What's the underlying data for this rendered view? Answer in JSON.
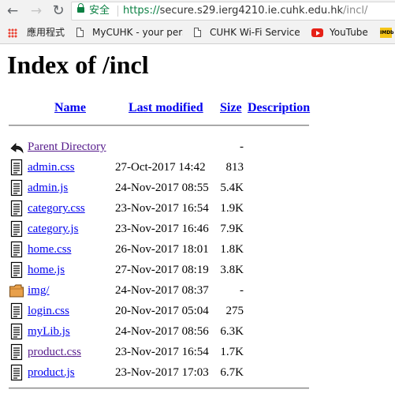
{
  "browser": {
    "secure_label": "安全",
    "url_scheme": "https://",
    "url_host": "secure.s29.ierg4210.ie.cuhk.edu.hk",
    "url_path": "/incl/"
  },
  "bookmarks": {
    "apps_label": "應用程式",
    "items": [
      {
        "label": "MyCUHK - your pers",
        "icon": "page-icon"
      },
      {
        "label": "CUHK Wi-Fi Service",
        "icon": "page-icon"
      },
      {
        "label": "YouTube",
        "icon": "youtube-icon"
      },
      {
        "label": "IMDb",
        "icon": "imdb-icon"
      }
    ]
  },
  "page": {
    "title": "Index of /incl",
    "columns": {
      "name": "Name",
      "last_modified": "Last modified",
      "size": "Size",
      "description": "Description"
    },
    "parent": {
      "label": "Parent Directory",
      "size": "-"
    },
    "files": [
      {
        "name": "admin.css",
        "date": "27-Oct-2017 14:42",
        "size": "813",
        "type": "text"
      },
      {
        "name": "admin.js",
        "date": "24-Nov-2017 08:55",
        "size": "5.4K",
        "type": "text"
      },
      {
        "name": "category.css",
        "date": "23-Nov-2017 16:54",
        "size": "1.9K",
        "type": "text"
      },
      {
        "name": "category.js",
        "date": "23-Nov-2017 16:46",
        "size": "7.9K",
        "type": "text"
      },
      {
        "name": "home.css",
        "date": "26-Nov-2017 18:01",
        "size": "1.8K",
        "type": "text"
      },
      {
        "name": "home.js",
        "date": "27-Nov-2017 08:19",
        "size": "3.8K",
        "type": "text"
      },
      {
        "name": "img/",
        "date": "24-Nov-2017 08:37",
        "size": "-",
        "type": "folder"
      },
      {
        "name": "login.css",
        "date": "20-Nov-2017 05:04",
        "size": "275",
        "type": "text"
      },
      {
        "name": "myLib.js",
        "date": "24-Nov-2017 08:56",
        "size": "6.3K",
        "type": "text"
      },
      {
        "name": "product.css",
        "date": "23-Nov-2017 16:54",
        "size": "1.7K",
        "type": "text"
      },
      {
        "name": "product.js",
        "date": "23-Nov-2017 17:03",
        "size": "6.7K",
        "type": "text"
      }
    ]
  },
  "colors": {
    "link": "#0000ee",
    "visited_link": "#551a8b",
    "secure_green": "#0b8043"
  }
}
